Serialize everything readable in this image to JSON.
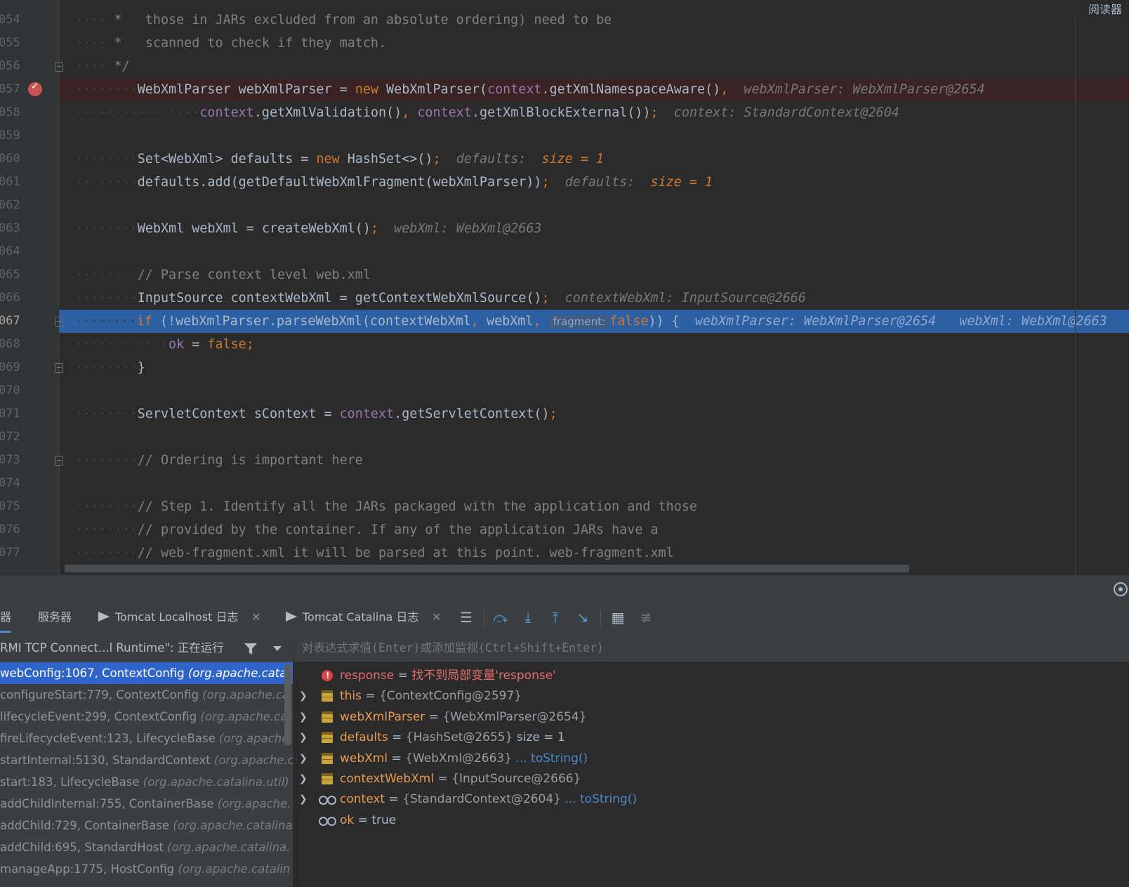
{
  "editor": {
    "reader_mode_label": "阅读器",
    "lines": [
      {
        "num": "054",
        "indent": "    ",
        "parts": [
          {
            "t": " *   those in JARs excluded from an absolute ordering) need to be",
            "c": "c"
          }
        ]
      },
      {
        "num": "055",
        "indent": "    ",
        "parts": [
          {
            "t": " *   scanned to check if they match.",
            "c": "c"
          }
        ]
      },
      {
        "num": "056",
        "indent": "    ",
        "parts": [
          {
            "t": " */",
            "c": "c"
          }
        ]
      },
      {
        "num": "057",
        "indent": "        ",
        "parts": [
          {
            "t": "WebXmlParser webXmlParser = "
          },
          {
            "t": "new",
            "c": "k"
          },
          {
            "t": " WebXmlParser("
          },
          {
            "t": "context",
            "c": "f"
          },
          {
            "t": ".getXmlNamespaceAware()"
          },
          {
            "t": ",",
            "c": "k"
          },
          {
            "t": "  webXmlParser: WebXmlParser@2654",
            "c": "hint"
          }
        ]
      },
      {
        "num": "058",
        "indent": "                ",
        "parts": [
          {
            "t": "context",
            "c": "f"
          },
          {
            "t": ".getXmlValidation()"
          },
          {
            "t": ",",
            "c": "k"
          },
          {
            "t": " "
          },
          {
            "t": "context",
            "c": "f"
          },
          {
            "t": ".getXmlBlockExternal())"
          },
          {
            "t": ";",
            "c": "k"
          },
          {
            "t": "  context: StandardContext@2604",
            "c": "hint"
          }
        ]
      },
      {
        "num": "059",
        "indent": "",
        "parts": []
      },
      {
        "num": "060",
        "indent": "        ",
        "parts": [
          {
            "t": "Set<WebXml> defaults = "
          },
          {
            "t": "new",
            "c": "k"
          },
          {
            "t": " HashSet<>()"
          },
          {
            "t": ";",
            "c": "k"
          },
          {
            "t": "  defaults:  ",
            "c": "hint"
          },
          {
            "t": "size = 1",
            "c": "hintv"
          }
        ]
      },
      {
        "num": "061",
        "indent": "        ",
        "parts": [
          {
            "t": "defaults.add(getDefaultWebXmlFragment(webXmlParser))"
          },
          {
            "t": ";",
            "c": "k"
          },
          {
            "t": "  defaults:  ",
            "c": "hint"
          },
          {
            "t": "size = 1",
            "c": "hintv"
          }
        ]
      },
      {
        "num": "062",
        "indent": "",
        "parts": []
      },
      {
        "num": "063",
        "indent": "        ",
        "parts": [
          {
            "t": "WebXml webXml = createWebXml()"
          },
          {
            "t": ";",
            "c": "k"
          },
          {
            "t": "  webXml: WebXml@2663",
            "c": "hint"
          }
        ]
      },
      {
        "num": "064",
        "indent": "",
        "parts": []
      },
      {
        "num": "065",
        "indent": "        ",
        "parts": [
          {
            "t": "// Parse context level web.xml",
            "c": "c"
          }
        ]
      },
      {
        "num": "066",
        "indent": "        ",
        "parts": [
          {
            "t": "InputSource contextWebXml = getContextWebXmlSource()"
          },
          {
            "t": ";",
            "c": "k"
          },
          {
            "t": "  contextWebXml: InputSource@2666",
            "c": "hint"
          }
        ]
      },
      {
        "num": "067",
        "indent": "        ",
        "parts": [
          {
            "t": "if",
            "c": "k"
          },
          {
            "t": " (!webXmlParser.parseWebXml(contextWebXml"
          },
          {
            "t": ",",
            "c": "k"
          },
          {
            "t": " webXml"
          },
          {
            "t": ",",
            "c": "k"
          },
          {
            "t": " "
          },
          {
            "t": "fragment:",
            "c": "param-hint"
          },
          {
            "t": "false",
            "c": "k"
          },
          {
            "t": ")) {"
          },
          {
            "t": "  webXmlParser: WebXmlParser@2654   webXml: WebXml@2663",
            "c": "hint"
          }
        ]
      },
      {
        "num": "068",
        "indent": "            ",
        "parts": [
          {
            "t": "ok",
            "c": "f"
          },
          {
            "t": " = "
          },
          {
            "t": "false",
            "c": "k"
          },
          {
            "t": ";",
            "c": "k"
          }
        ]
      },
      {
        "num": "069",
        "indent": "        ",
        "parts": [
          {
            "t": "}"
          }
        ]
      },
      {
        "num": "070",
        "indent": "",
        "parts": []
      },
      {
        "num": "071",
        "indent": "        ",
        "parts": [
          {
            "t": "ServletContext sContext = "
          },
          {
            "t": "context",
            "c": "f"
          },
          {
            "t": ".getServletContext()"
          },
          {
            "t": ";",
            "c": "k"
          }
        ]
      },
      {
        "num": "072",
        "indent": "",
        "parts": []
      },
      {
        "num": "073",
        "indent": "        ",
        "parts": [
          {
            "t": "// Ordering is important here",
            "c": "c"
          }
        ]
      },
      {
        "num": "074",
        "indent": "",
        "parts": []
      },
      {
        "num": "075",
        "indent": "        ",
        "parts": [
          {
            "t": "// Step 1. Identify all the JARs packaged with the application and those",
            "c": "c"
          }
        ]
      },
      {
        "num": "076",
        "indent": "        ",
        "parts": [
          {
            "t": "// provided by the container. If any of the application JARs have a",
            "c": "c"
          }
        ]
      },
      {
        "num": "077",
        "indent": "        ",
        "parts": [
          {
            "t": "// web-fragment.xml it will be parsed at this point. web-fragment.xml",
            "c": "c"
          }
        ]
      }
    ]
  },
  "debug": {
    "tabs": [
      {
        "label": "器"
      },
      {
        "label": "服务器"
      },
      {
        "label": "Tomcat Localhost 日志"
      },
      {
        "label": "Tomcat Catalina 日志"
      }
    ],
    "toolbar": {
      "icons": [
        "frames-icon",
        "step-over-icon",
        "step-into-icon",
        "step-out-icon",
        "run-to-cursor-icon",
        "evaluate-icon",
        "trace-icon"
      ]
    },
    "thread": "RMI TCP Connect...l Runtime\": 正在运行",
    "frames": [
      {
        "method": "webConfig:1067, ContextConfig",
        "pkg": "(org.apache.catal"
      },
      {
        "method": "configureStart:779, ContextConfig",
        "pkg": "(org.apache.ca"
      },
      {
        "method": "lifecycleEvent:299, ContextConfig",
        "pkg": "(org.apache.cata"
      },
      {
        "method": "fireLifecycleEvent:123, LifecycleBase",
        "pkg": "(org.apache.c"
      },
      {
        "method": "startInternal:5130, StandardContext",
        "pkg": "(org.apache.c"
      },
      {
        "method": "start:183, LifecycleBase",
        "pkg": "(org.apache.catalina.util)"
      },
      {
        "method": "addChildInternal:755, ContainerBase",
        "pkg": "(org.apache."
      },
      {
        "method": "addChild:729, ContainerBase",
        "pkg": "(org.apache.catalina."
      },
      {
        "method": "addChild:695, StandardHost",
        "pkg": "(org.apache.catalina."
      },
      {
        "method": "manageApp:1775, HostConfig",
        "pkg": "(org.apache.catalin"
      }
    ],
    "evaluate_placeholder": "对表达式求值(Enter)或添加监视(Ctrl+Shift+Enter)",
    "variables": [
      {
        "name": "response",
        "eq": " = ",
        "value": "找不到局部变量'response'",
        "icon": "error",
        "expandable": false,
        "kind": "error"
      },
      {
        "name": "this",
        "eq": " = ",
        "value": "{ContextConfig@2597}",
        "icon": "field",
        "expandable": true
      },
      {
        "name": "webXmlParser",
        "eq": " = ",
        "value": "{WebXmlParser@2654}",
        "icon": "field",
        "expandable": true
      },
      {
        "name": "defaults",
        "eq": " = ",
        "value": "{HashSet@2655}",
        "extra": "size = 1",
        "icon": "field",
        "expandable": true
      },
      {
        "name": "webXml",
        "eq": " = ",
        "value": "{WebXml@2663}",
        "link": "... toString()",
        "icon": "field",
        "expandable": true
      },
      {
        "name": "contextWebXml",
        "eq": " = ",
        "value": "{InputSource@2666}",
        "icon": "field",
        "expandable": true
      },
      {
        "name": "context",
        "eq": " = ",
        "value": "{StandardContext@2604}",
        "link": "... toString()",
        "icon": "watch",
        "expandable": true
      },
      {
        "name": "ok",
        "eq": " = ",
        "value": "true",
        "icon": "watch",
        "expandable": false
      }
    ]
  }
}
